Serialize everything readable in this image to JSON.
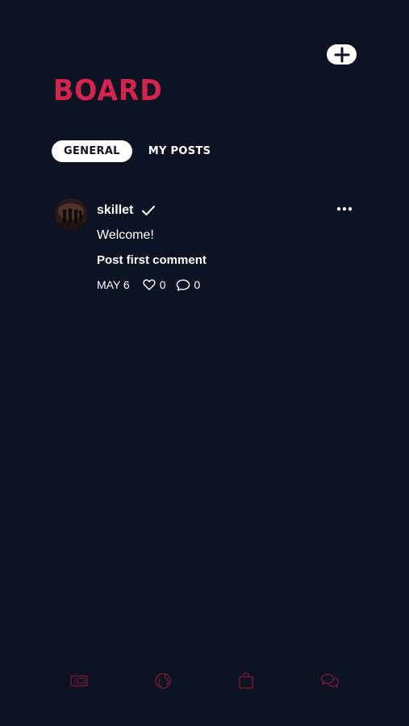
{
  "header": {
    "title": "BOARD",
    "add_icon": "plus-icon"
  },
  "tabs": [
    {
      "label": "GENERAL",
      "active": true
    },
    {
      "label": "MY POSTS",
      "active": false
    }
  ],
  "post": {
    "author": "skillet",
    "verified_icon": "check-icon",
    "body": "Welcome!",
    "action_label": "Post first comment",
    "date": "MAY 6",
    "likes": "0",
    "comments": "0",
    "more_icon": "more-horizontal-icon"
  },
  "bottom_nav": [
    {
      "icon": "ticket-icon"
    },
    {
      "icon": "globe-icon"
    },
    {
      "icon": "shopping-bag-icon"
    },
    {
      "icon": "chat-bubbles-icon"
    }
  ],
  "colors": {
    "background": "#0e1324",
    "accent": "#d2254d",
    "text": "#ffffff",
    "nav_icon": "#6d1a33"
  }
}
